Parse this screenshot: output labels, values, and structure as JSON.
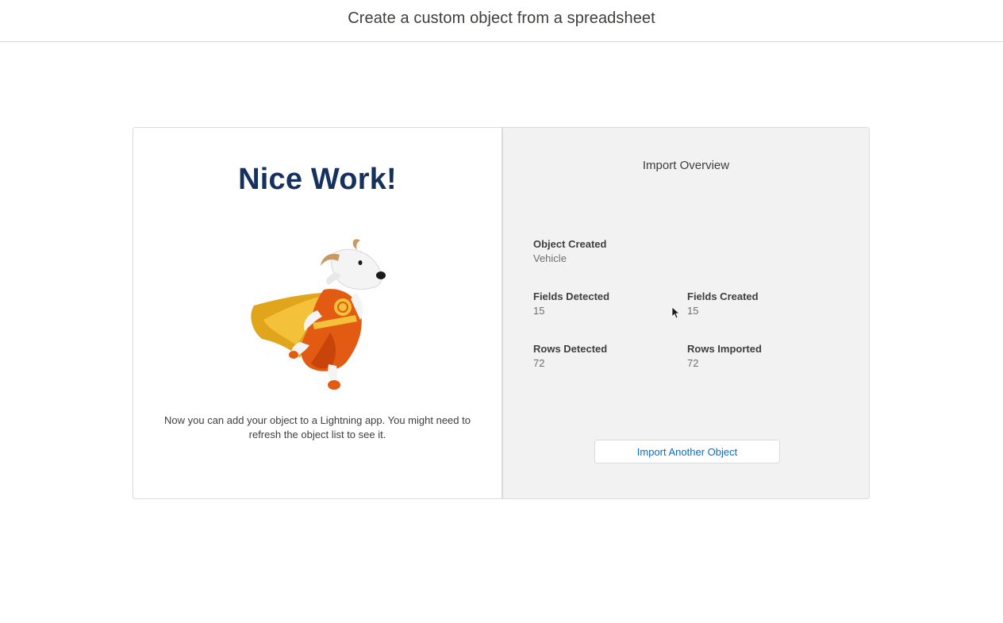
{
  "header": {
    "title": "Create a custom object from a spreadsheet"
  },
  "left_panel": {
    "headline": "Nice Work!",
    "mascot_icon": "goat-superhero-mascot-icon",
    "note": "Now you can add your object to a Lightning app. You might need to refresh the object list to see it."
  },
  "right_panel": {
    "title": "Import Overview",
    "object_created": {
      "label": "Object Created",
      "value": "Vehicle"
    },
    "fields_detected": {
      "label": "Fields Detected",
      "value": "15"
    },
    "fields_created": {
      "label": "Fields Created",
      "value": "15"
    },
    "rows_detected": {
      "label": "Rows Detected",
      "value": "72"
    },
    "rows_imported": {
      "label": "Rows Imported",
      "value": "72"
    },
    "button_label": "Import Another Object"
  },
  "colors": {
    "headline": "#16325c",
    "link": "#0070d2",
    "panel_bg": "#f3f2f2",
    "border": "#dddbda"
  }
}
